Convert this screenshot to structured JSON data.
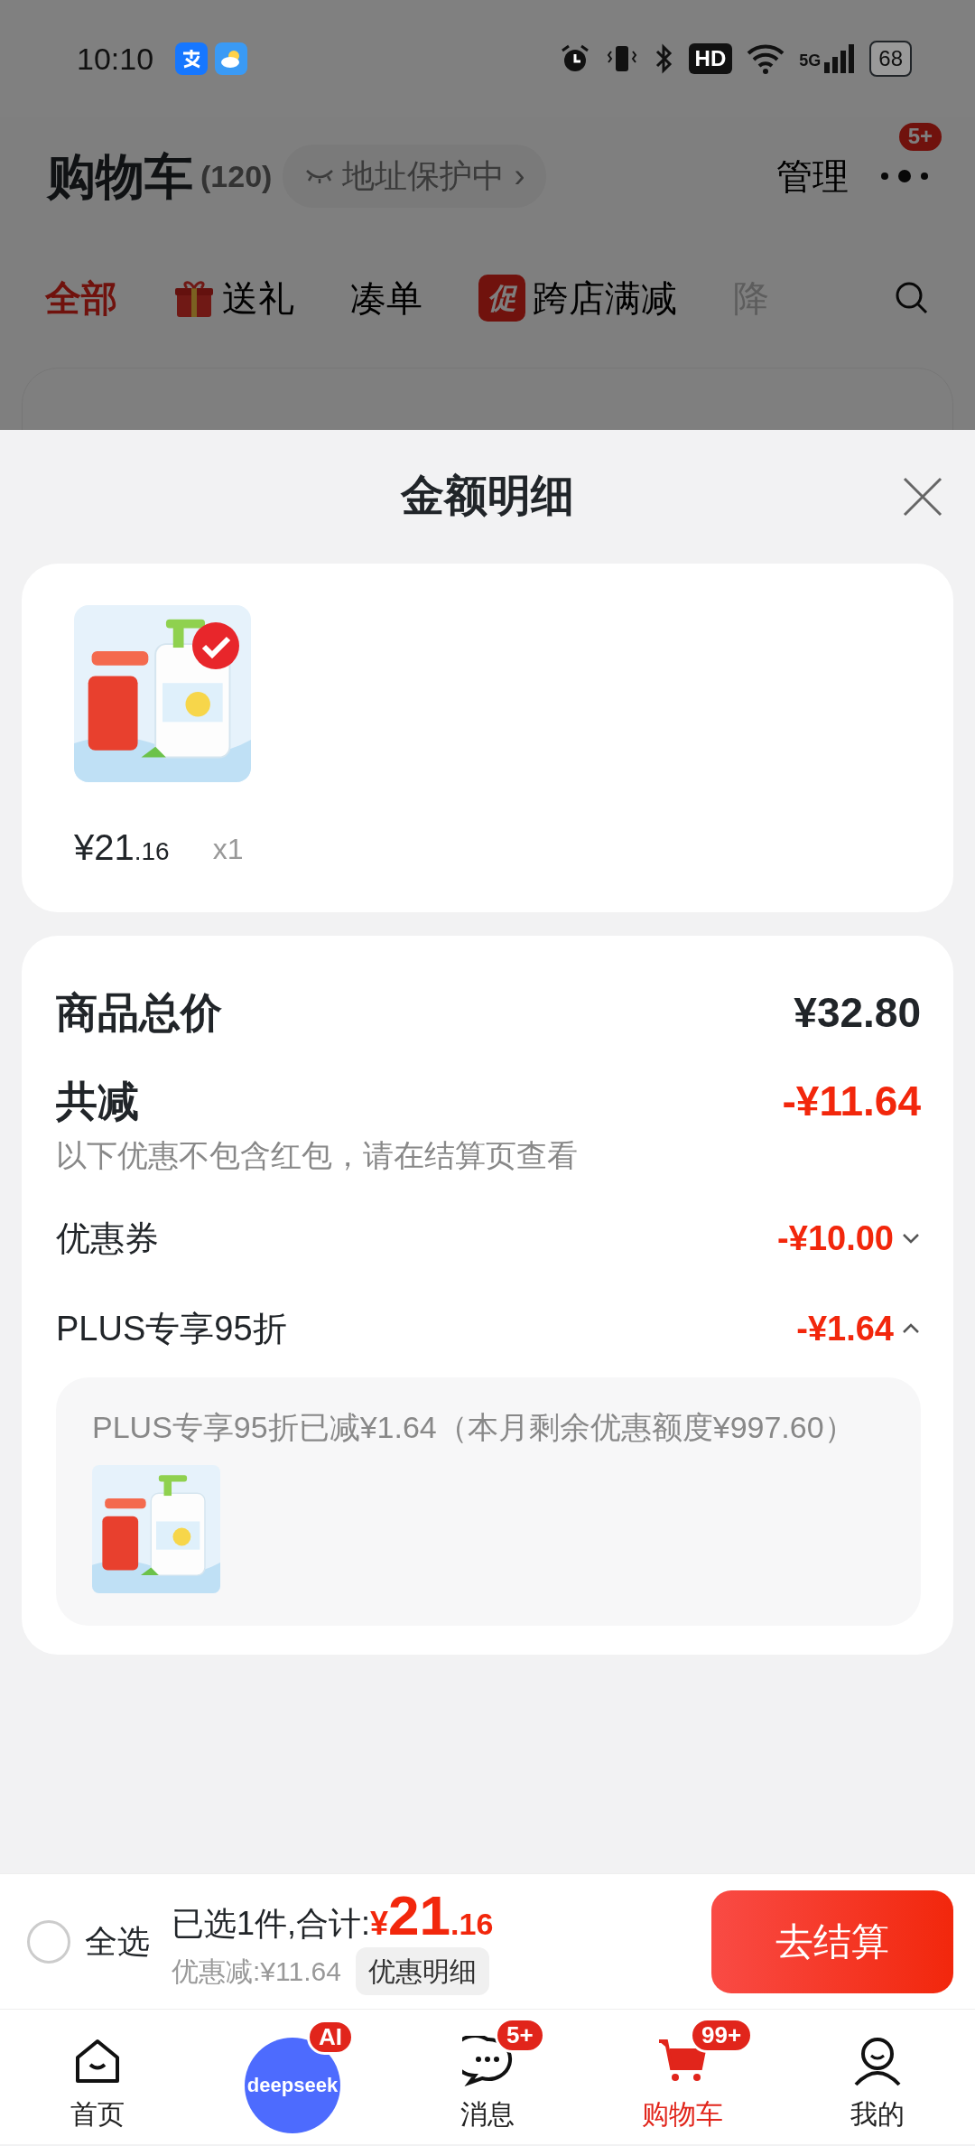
{
  "status_bar": {
    "time": "10:10",
    "hd": "HD",
    "network": "5G",
    "battery": "68"
  },
  "header": {
    "title": "购物车",
    "count": "(120)",
    "address_chip": "地址保护中",
    "chip_chevron": "›",
    "manage": "管理",
    "more_badge": "5+"
  },
  "filter_tabs": [
    {
      "kind": "plain",
      "label": "全部",
      "selected": true
    },
    {
      "kind": "gift",
      "label": "送礼",
      "selected": false
    },
    {
      "kind": "plain",
      "label": "凑单",
      "selected": false
    },
    {
      "kind": "promo",
      "tag": "促",
      "label": "跨店满减",
      "selected": false
    },
    {
      "kind": "faded",
      "label": "降",
      "selected": false
    }
  ],
  "sheet": {
    "title": "金额明细"
  },
  "product": {
    "checked": true,
    "price_int": "¥21",
    "price_dec": ".16",
    "quantity": "x1"
  },
  "summary": {
    "rows": [
      {
        "kind": "total",
        "label": "商品总价",
        "amount": "¥32.80"
      },
      {
        "kind": "discount",
        "label": "共减",
        "amount": "-¥11.64",
        "note": "以下优惠不包含红包，请在结算页查看"
      },
      {
        "kind": "item",
        "label": "优惠券",
        "amount": "-¥10.00",
        "expanded": false
      },
      {
        "kind": "item",
        "label": "PLUS专享95折",
        "amount": "-¥1.64",
        "expanded": true,
        "detail": "PLUS专享95折已减¥1.64（本月剩余优惠额度¥997.60）"
      }
    ]
  },
  "checkout_bar": {
    "select_all": {
      "label": "全选",
      "checked": false
    },
    "selected_text": "已选1件,合计:",
    "total_currency": "¥",
    "total_int": "21",
    "total_dec": ".16",
    "discount_text": "优惠减:¥11.64",
    "detail_button": "优惠明细",
    "checkout_button": "去结算"
  },
  "bottom_nav": [
    {
      "kind": "home",
      "label": "首页",
      "selected": false
    },
    {
      "kind": "deepseek",
      "logo_text": "deepseek",
      "badge": "AI",
      "selected": false
    },
    {
      "kind": "message",
      "label": "消息",
      "badge": "5+",
      "selected": false
    },
    {
      "kind": "cart",
      "label": "购物车",
      "badge": "99+",
      "selected": true
    },
    {
      "kind": "profile",
      "label": "我的",
      "selected": false
    }
  ]
}
